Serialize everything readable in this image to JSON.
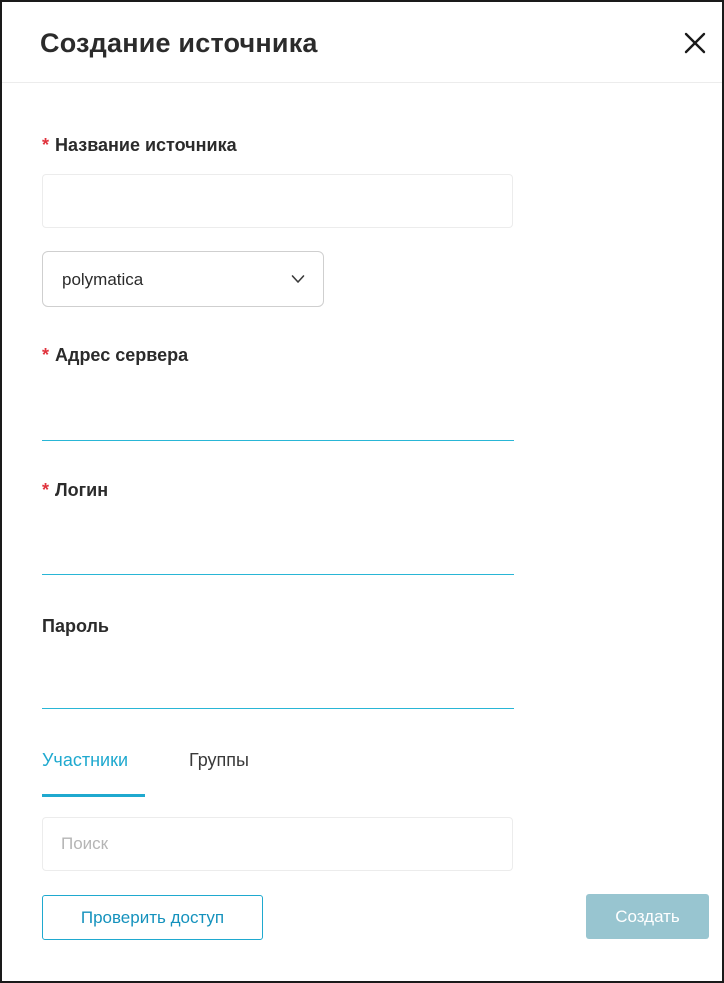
{
  "dialog": {
    "title": "Создание источника"
  },
  "form": {
    "name_label": "Название источника",
    "name_value": "",
    "source_type": "polymatica",
    "server_label": "Адрес сервера",
    "server_value": "",
    "login_label": "Логин",
    "login_value": "",
    "password_label": "Пароль",
    "password_value": ""
  },
  "required_marker": "*",
  "tabs": [
    {
      "label": "Участники",
      "active": true
    },
    {
      "label": "Группы",
      "active": false
    }
  ],
  "search": {
    "placeholder": "Поиск",
    "value": ""
  },
  "buttons": {
    "check_access": "Проверить доступ",
    "create": "Создать"
  },
  "colors": {
    "accent": "#1fa9cf",
    "required": "#e0323c",
    "create_disabled": "#98c5d0"
  },
  "icons": {
    "close": "close-icon",
    "dropdown": "chevron-down-icon"
  }
}
